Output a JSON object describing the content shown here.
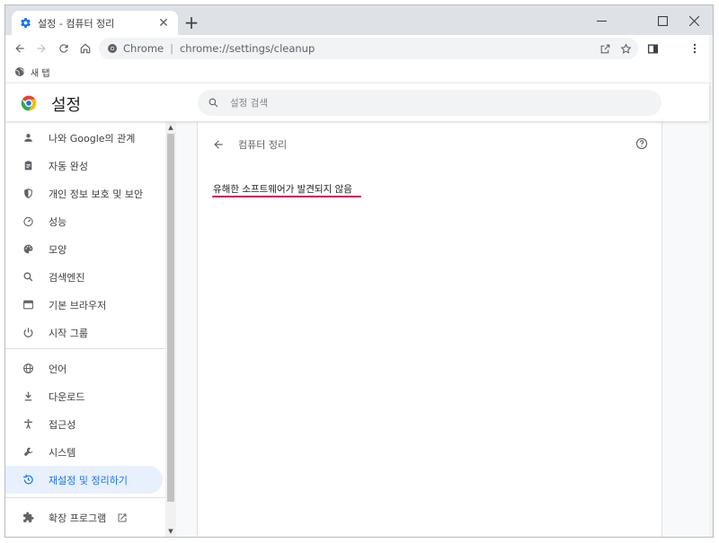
{
  "tab": {
    "title": "설정 - 컴퓨터 정리",
    "close_symbol": "✕",
    "new_tab_symbol": "+"
  },
  "window_controls": {
    "minimize": "─",
    "maximize": "☐",
    "close": "✕"
  },
  "omnibox": {
    "site_label": "Chrome",
    "separator": "|",
    "url": "chrome://settings/cleanup"
  },
  "bookmarks": [
    {
      "label": "새 탭"
    }
  ],
  "header": {
    "title": "설정",
    "search_placeholder": "설정 검색"
  },
  "sidebar": {
    "items": [
      {
        "label": "나와 Google의 관계",
        "icon": "person-icon"
      },
      {
        "label": "자동 완성",
        "icon": "clipboard-icon"
      },
      {
        "label": "개인 정보 보호 및 보안",
        "icon": "shield-icon"
      },
      {
        "label": "성능",
        "icon": "speedometer-icon"
      },
      {
        "label": "모양",
        "icon": "palette-icon"
      },
      {
        "label": "검색엔진",
        "icon": "search-icon"
      },
      {
        "label": "기본 브라우저",
        "icon": "browser-icon"
      },
      {
        "label": "시작 그룹",
        "icon": "power-icon"
      },
      {
        "label": "언어",
        "icon": "globe-icon"
      },
      {
        "label": "다운로드",
        "icon": "download-icon"
      },
      {
        "label": "접근성",
        "icon": "accessibility-icon"
      },
      {
        "label": "시스템",
        "icon": "wrench-icon"
      },
      {
        "label": "재설정 및 정리하기",
        "icon": "history-icon",
        "active": true
      },
      {
        "label": "확장 프로그램",
        "icon": "puzzle-icon"
      }
    ]
  },
  "main": {
    "page_title": "컴퓨터 정리",
    "status": "유해한 소프트웨어가 발견되지 않음"
  },
  "colors": {
    "accent": "#1a73e8",
    "active_bg": "#e8f0fe",
    "underline": "#c2185b"
  }
}
